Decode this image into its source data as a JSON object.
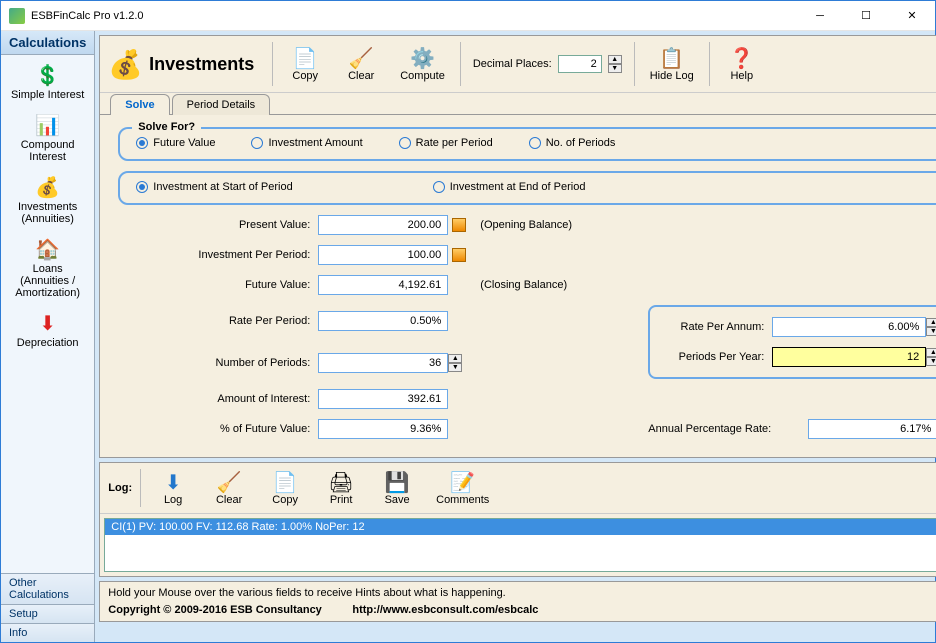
{
  "window": {
    "title": "ESBFinCalc Pro v1.2.0"
  },
  "sidebar": {
    "header": "Calculations",
    "items": [
      {
        "label": "Simple Interest",
        "icon": "💲"
      },
      {
        "label": "Compound Interest",
        "icon": "📊"
      },
      {
        "label": "Investments (Annuities)",
        "icon": "💰"
      },
      {
        "label": "Loans (Annuities / Amortization)",
        "icon": "🏠"
      },
      {
        "label": "Depreciation",
        "icon": "⬇"
      }
    ],
    "bottom": [
      "Other Calculations",
      "Setup",
      "Info"
    ]
  },
  "toolbar": {
    "heading": "Investments",
    "copy": "Copy",
    "clear": "Clear",
    "compute": "Compute",
    "decimal_label": "Decimal Places:",
    "decimal_value": "2",
    "hidelog": "Hide Log",
    "help": "Help"
  },
  "tabs": {
    "solve": "Solve",
    "period": "Period Details"
  },
  "solvefor": {
    "legend": "Solve For?",
    "opts": [
      "Future Value",
      "Investment Amount",
      "Rate per Period",
      "No. of Periods"
    ],
    "timing": [
      "Investment at Start of Period",
      "Investment at End of Period"
    ]
  },
  "fields": {
    "present_value_lbl": "Present Value:",
    "present_value": "200.00",
    "opening": "(Opening Balance)",
    "inv_per_period_lbl": "Investment Per Period:",
    "inv_per_period": "100.00",
    "future_value_lbl": "Future Value:",
    "future_value": "4,192.61",
    "closing": "(Closing Balance)",
    "rate_period_lbl": "Rate Per Period:",
    "rate_period": "0.50%",
    "num_periods_lbl": "Number of Periods:",
    "num_periods": "36",
    "amt_interest_lbl": "Amount of Interest:",
    "amt_interest": "392.61",
    "pct_fv_lbl": "% of Future Value:",
    "pct_fv": "9.36%",
    "rate_annum_lbl": "Rate Per Annum:",
    "rate_annum": "6.00%",
    "periods_year_lbl": "Periods Per Year:",
    "periods_year": "12",
    "apr_lbl": "Annual Percentage Rate:",
    "apr": "6.17%"
  },
  "log": {
    "label": "Log:",
    "btns": {
      "log": "Log",
      "clear": "Clear",
      "copy": "Copy",
      "print": "Print",
      "save": "Save",
      "comments": "Comments"
    },
    "entry": "CI(1) PV: 100.00 FV: 112.68 Rate: 1.00% NoPer: 12"
  },
  "status": {
    "hint": "Hold your Mouse over the various fields to receive Hints about what is happening.",
    "copyright": "Copyright © 2009-2016 ESB Consultancy",
    "url": "http://www.esbconsult.com/esbcalc"
  }
}
